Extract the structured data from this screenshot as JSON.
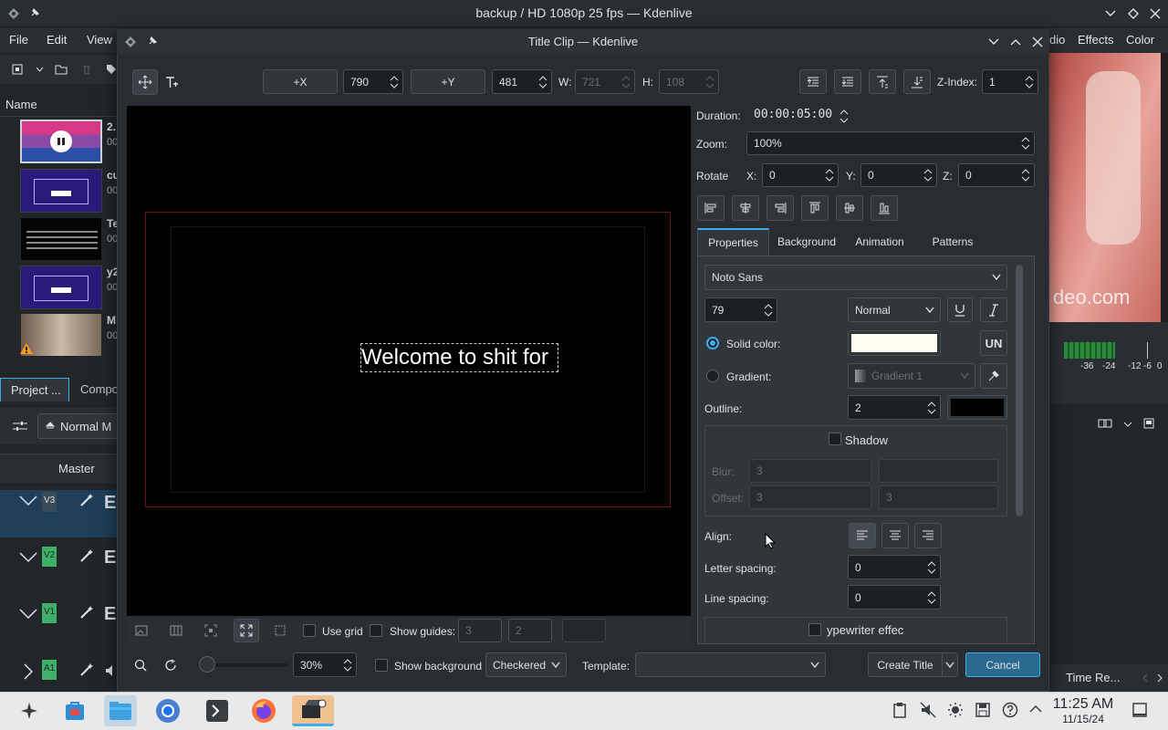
{
  "window": {
    "title": "backup / HD 1080p 25 fps — Kdenlive"
  },
  "menubar": {
    "items": [
      "File",
      "Edit",
      "View"
    ],
    "right_items": [
      "Effects",
      "Color"
    ],
    "partial_item": "dio"
  },
  "project": {
    "column_name": "Name",
    "clips": [
      {
        "name": "2.",
        "dur": "00"
      },
      {
        "name": "cu",
        "dur": "00"
      },
      {
        "name": "Te",
        "dur": "00"
      },
      {
        "name": "y2",
        "dur": "00"
      },
      {
        "name": "M",
        "dur": "00"
      }
    ],
    "tabs": [
      "Project ...",
      "Compo"
    ],
    "mix_mode": "Normal M",
    "master": "Master",
    "tracks": [
      "V3",
      "V2",
      "V1",
      "A1"
    ]
  },
  "monitor": {
    "watermark": "deo.com",
    "meter_labels": [
      "-36",
      "-24",
      "-12",
      "-6",
      "0"
    ],
    "time_remaining": "Time Re..."
  },
  "dialog": {
    "title": "Title Clip — Kdenlive",
    "toolbar": {
      "x_label": "+X",
      "x_value": "790",
      "y_label": "+Y",
      "y_value": "481",
      "w_label": "W:",
      "w_value": "721",
      "h_label": "H:",
      "h_value": "108",
      "zindex_label": "Z-Index:",
      "zindex_value": "1"
    },
    "canvas": {
      "text": "Welcome to shit for"
    },
    "duration_label": "Duration:",
    "duration_value": "00:00:05:00",
    "zoom_label": "Zoom:",
    "zoom_value": "100%",
    "rotate_label": "Rotate",
    "rx_label": "X:",
    "rx_value": "0",
    "ry_label": "Y:",
    "ry_value": "0",
    "rz_label": "Z:",
    "rz_value": "0",
    "tabs": [
      "Properties",
      "Background",
      "Animation",
      "Patterns"
    ],
    "font": "Noto Sans",
    "font_size": "79",
    "font_weight": "Normal",
    "solid_color_label": "Solid color:",
    "solid_color": "#fffff0",
    "gradient_label": "Gradient:",
    "gradient_value": "Gradient 1",
    "outline_label": "Outline:",
    "outline_value": "2",
    "outline_color": "#000000",
    "shadow_label": "Shadow",
    "blur_label": "Blur:",
    "blur_value": "3",
    "offset_label": "Offset:",
    "offset_value_1": "3",
    "offset_value_2": "3",
    "align_label": "Align:",
    "letter_spacing_label": "Letter spacing:",
    "letter_spacing_value": "0",
    "line_spacing_label": "Line spacing:",
    "line_spacing_value": "0",
    "typewriter_label": "ypewriter effec",
    "bottom": {
      "use_grid": "Use grid",
      "show_guides": "Show guides:",
      "guide_h": "3",
      "guide_v": "2",
      "zoom_value": "30%",
      "show_background": "Show background",
      "bg_mode": "Checkered",
      "template_label": "Template:",
      "template_value": "",
      "create_title": "Create Title",
      "cancel": "Cancel"
    }
  },
  "taskbar": {
    "time": "11:25 AM",
    "date": "11/15/24"
  },
  "colors": {
    "accent": "#3daee9",
    "track_green": "#3fb06a"
  }
}
